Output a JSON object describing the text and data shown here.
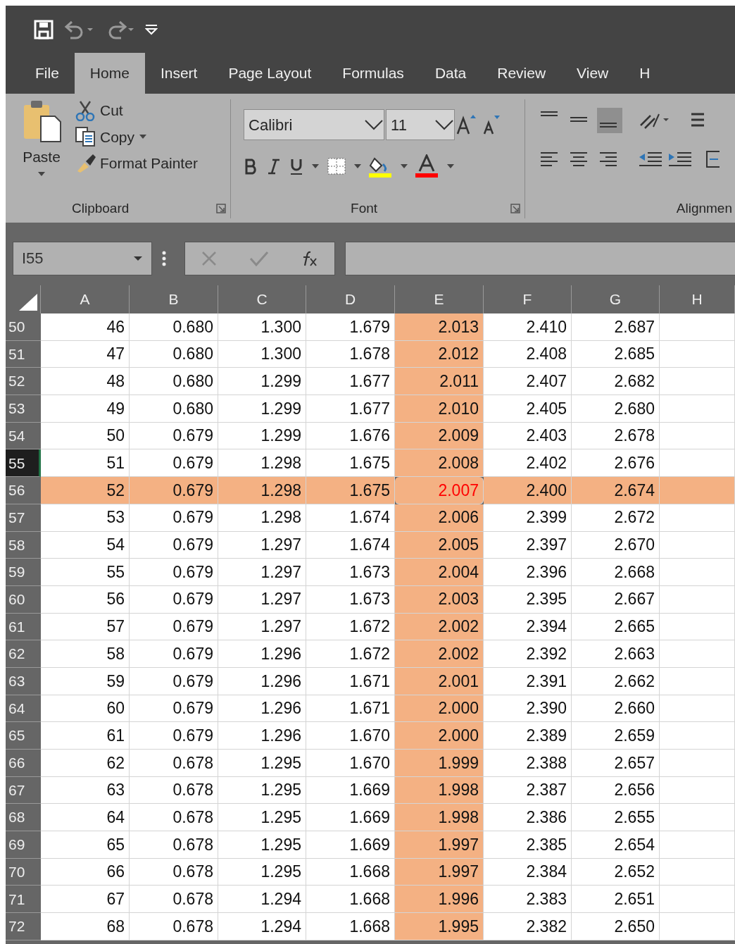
{
  "tabs": [
    {
      "label": "File",
      "selected": false
    },
    {
      "label": "Home",
      "selected": true
    },
    {
      "label": "Insert",
      "selected": false
    },
    {
      "label": "Page Layout",
      "selected": false
    },
    {
      "label": "Formulas",
      "selected": false
    },
    {
      "label": "Data",
      "selected": false
    },
    {
      "label": "Review",
      "selected": false
    },
    {
      "label": "View",
      "selected": false
    },
    {
      "label": "H",
      "selected": false
    }
  ],
  "ribbon": {
    "clipboard": {
      "label": "Clipboard",
      "paste": "Paste",
      "cut": "Cut",
      "copy": "Copy",
      "format_painter": "Format Painter"
    },
    "font": {
      "label": "Font",
      "font_name": "Calibri",
      "font_size": "11"
    },
    "alignment": {
      "label": "Alignmen",
      "vertical_buttons": [
        {
          "selected": false
        },
        {
          "selected": false
        },
        {
          "selected": true
        }
      ]
    }
  },
  "formula_bar": {
    "name_box": "I55"
  },
  "columns": [
    {
      "label": "A",
      "highlighted": false
    },
    {
      "label": "B",
      "highlighted": false
    },
    {
      "label": "C",
      "highlighted": false
    },
    {
      "label": "D",
      "highlighted": false
    },
    {
      "label": "E",
      "highlighted": true
    },
    {
      "label": "F",
      "highlighted": false
    },
    {
      "label": "G",
      "highlighted": false
    },
    {
      "label": "H",
      "highlighted": false
    }
  ],
  "rows": [
    {
      "number": "50",
      "cells": [
        "46",
        "0.680",
        "1.300",
        "1.679",
        "2.013",
        "2.410",
        "2.687"
      ],
      "selected": false,
      "highlighted": false,
      "alert": false
    },
    {
      "number": "51",
      "cells": [
        "47",
        "0.680",
        "1.300",
        "1.678",
        "2.012",
        "2.408",
        "2.685"
      ],
      "selected": false,
      "highlighted": false,
      "alert": false
    },
    {
      "number": "52",
      "cells": [
        "48",
        "0.680",
        "1.299",
        "1.677",
        "2.011",
        "2.407",
        "2.682"
      ],
      "selected": false,
      "highlighted": false,
      "alert": false
    },
    {
      "number": "53",
      "cells": [
        "49",
        "0.680",
        "1.299",
        "1.677",
        "2.010",
        "2.405",
        "2.680"
      ],
      "selected": false,
      "highlighted": false,
      "alert": false
    },
    {
      "number": "54",
      "cells": [
        "50",
        "0.679",
        "1.299",
        "1.676",
        "2.009",
        "2.403",
        "2.678"
      ],
      "selected": false,
      "highlighted": false,
      "alert": false
    },
    {
      "number": "55",
      "cells": [
        "51",
        "0.679",
        "1.298",
        "1.675",
        "2.008",
        "2.402",
        "2.676"
      ],
      "selected": true,
      "highlighted": false,
      "alert": false
    },
    {
      "number": "56",
      "cells": [
        "52",
        "0.679",
        "1.298",
        "1.675",
        "2.007",
        "2.400",
        "2.674"
      ],
      "selected": false,
      "highlighted": true,
      "alert": true
    },
    {
      "number": "57",
      "cells": [
        "53",
        "0.679",
        "1.298",
        "1.674",
        "2.006",
        "2.399",
        "2.672"
      ],
      "selected": false,
      "highlighted": false,
      "alert": false
    },
    {
      "number": "58",
      "cells": [
        "54",
        "0.679",
        "1.297",
        "1.674",
        "2.005",
        "2.397",
        "2.670"
      ],
      "selected": false,
      "highlighted": false,
      "alert": false
    },
    {
      "number": "59",
      "cells": [
        "55",
        "0.679",
        "1.297",
        "1.673",
        "2.004",
        "2.396",
        "2.668"
      ],
      "selected": false,
      "highlighted": false,
      "alert": false
    },
    {
      "number": "60",
      "cells": [
        "56",
        "0.679",
        "1.297",
        "1.673",
        "2.003",
        "2.395",
        "2.667"
      ],
      "selected": false,
      "highlighted": false,
      "alert": false
    },
    {
      "number": "61",
      "cells": [
        "57",
        "0.679",
        "1.297",
        "1.672",
        "2.002",
        "2.394",
        "2.665"
      ],
      "selected": false,
      "highlighted": false,
      "alert": false
    },
    {
      "number": "62",
      "cells": [
        "58",
        "0.679",
        "1.296",
        "1.672",
        "2.002",
        "2.392",
        "2.663"
      ],
      "selected": false,
      "highlighted": false,
      "alert": false
    },
    {
      "number": "63",
      "cells": [
        "59",
        "0.679",
        "1.296",
        "1.671",
        "2.001",
        "2.391",
        "2.662"
      ],
      "selected": false,
      "highlighted": false,
      "alert": false
    },
    {
      "number": "64",
      "cells": [
        "60",
        "0.679",
        "1.296",
        "1.671",
        "2.000",
        "2.390",
        "2.660"
      ],
      "selected": false,
      "highlighted": false,
      "alert": false
    },
    {
      "number": "65",
      "cells": [
        "61",
        "0.679",
        "1.296",
        "1.670",
        "2.000",
        "2.389",
        "2.659"
      ],
      "selected": false,
      "highlighted": false,
      "alert": false
    },
    {
      "number": "66",
      "cells": [
        "62",
        "0.678",
        "1.295",
        "1.670",
        "1.999",
        "2.388",
        "2.657"
      ],
      "selected": false,
      "highlighted": false,
      "alert": false
    },
    {
      "number": "67",
      "cells": [
        "63",
        "0.678",
        "1.295",
        "1.669",
        "1.998",
        "2.387",
        "2.656"
      ],
      "selected": false,
      "highlighted": false,
      "alert": false
    },
    {
      "number": "68",
      "cells": [
        "64",
        "0.678",
        "1.295",
        "1.669",
        "1.998",
        "2.386",
        "2.655"
      ],
      "selected": false,
      "highlighted": false,
      "alert": false
    },
    {
      "number": "69",
      "cells": [
        "65",
        "0.678",
        "1.295",
        "1.669",
        "1.997",
        "2.385",
        "2.654"
      ],
      "selected": false,
      "highlighted": false,
      "alert": false
    },
    {
      "number": "70",
      "cells": [
        "66",
        "0.678",
        "1.295",
        "1.668",
        "1.997",
        "2.384",
        "2.652"
      ],
      "selected": false,
      "highlighted": false,
      "alert": false
    },
    {
      "number": "71",
      "cells": [
        "67",
        "0.678",
        "1.294",
        "1.668",
        "1.996",
        "2.383",
        "2.651"
      ],
      "selected": false,
      "highlighted": false,
      "alert": false
    },
    {
      "number": "72",
      "cells": [
        "68",
        "0.678",
        "1.294",
        "1.668",
        "1.995",
        "2.382",
        "2.650"
      ],
      "selected": false,
      "highlighted": false,
      "alert": false
    }
  ]
}
